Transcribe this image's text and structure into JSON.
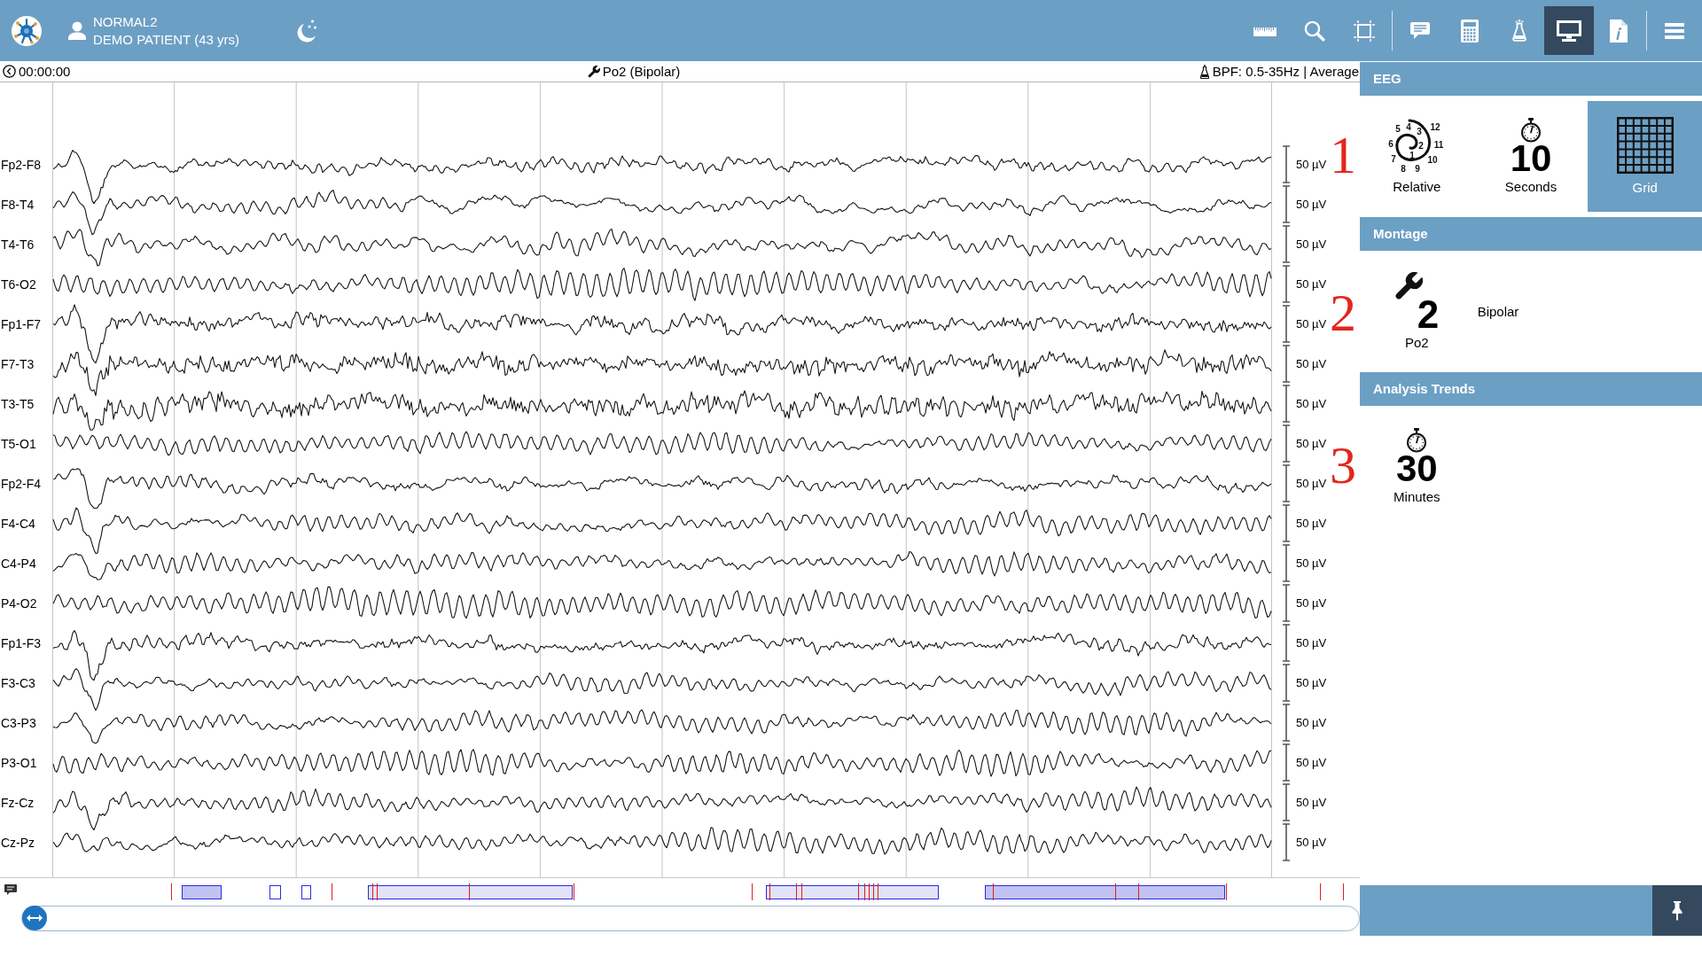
{
  "header": {
    "patient_name": "NORMAL2",
    "patient_details": "DEMO PATIENT (43 yrs)",
    "toolbar": [
      [
        {
          "selected": false
        },
        {
          "selected": false
        },
        {
          "selected": false
        }
      ],
      [
        {
          "selected": false
        },
        {
          "selected": false
        },
        {
          "selected": false
        },
        {
          "selected": true
        },
        {
          "selected": false
        }
      ],
      [
        {
          "selected": false
        }
      ]
    ]
  },
  "status": {
    "time": "00:00:00",
    "montage": "Po2 (Bipolar)",
    "filter": "BPF: 0.5-35Hz | Average"
  },
  "channels": [
    {
      "label": "Fp2-F8",
      "scale": "50 µV"
    },
    {
      "label": "F8-T4",
      "scale": "50 µV"
    },
    {
      "label": "T4-T6",
      "scale": "50 µV"
    },
    {
      "label": "T6-O2",
      "scale": "50 µV"
    },
    {
      "label": "Fp1-F7",
      "scale": "50 µV"
    },
    {
      "label": "F7-T3",
      "scale": "50 µV"
    },
    {
      "label": "T3-T5",
      "scale": "50 µV"
    },
    {
      "label": "T5-O1",
      "scale": "50 µV"
    },
    {
      "label": "Fp2-F4",
      "scale": "50 µV"
    },
    {
      "label": "F4-C4",
      "scale": "50 µV"
    },
    {
      "label": "C4-P4",
      "scale": "50 µV"
    },
    {
      "label": "P4-O2",
      "scale": "50 µV"
    },
    {
      "label": "Fp1-F3",
      "scale": "50 µV"
    },
    {
      "label": "F3-C3",
      "scale": "50 µV"
    },
    {
      "label": "C3-P3",
      "scale": "50 µV"
    },
    {
      "label": "P3-O1",
      "scale": "50 µV"
    },
    {
      "label": "Fz-Cz",
      "scale": "50 µV"
    },
    {
      "label": "Cz-Pz",
      "scale": "50 µV"
    }
  ],
  "callouts": [
    "1",
    "2",
    "3"
  ],
  "panel": {
    "sections": [
      {
        "title": "EEG",
        "tiles": [
          {
            "kind": "dial",
            "dial": [
              "5",
              "4",
              "3",
              "12",
              "6",
              "2",
              "11",
              "7",
              "1",
              "10",
              "8",
              "9"
            ],
            "label": "Relative",
            "selected": false
          },
          {
            "kind": "timer",
            "value": "10",
            "label": "Seconds",
            "selected": false
          },
          {
            "kind": "grid",
            "label": "Grid",
            "selected": true
          }
        ]
      },
      {
        "title": "Montage",
        "tiles": [
          {
            "kind": "montage",
            "value": "2",
            "label": "Po2",
            "selected": false
          }
        ],
        "description": "Bipolar"
      },
      {
        "title": "Analysis Trends",
        "tiles": [
          {
            "kind": "timer",
            "value": "30",
            "label": "Minutes",
            "selected": false
          }
        ]
      }
    ]
  }
}
